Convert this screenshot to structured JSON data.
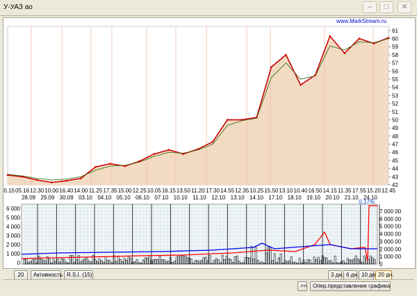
{
  "window": {
    "title": "У-УАЗ ао"
  },
  "watermark": "www.MarkStream.ru",
  "price_chart": {
    "y_ticks": [
      "61",
      "60",
      "59",
      "58",
      "57",
      "56",
      "55",
      "54",
      "53",
      "52",
      "51",
      "50",
      "49",
      "48",
      "47",
      "46",
      "45",
      "44",
      "43",
      "42"
    ],
    "x_labels": [
      "20.15",
      "05.16",
      "12.30",
      "10.00",
      "16.40",
      "14.00",
      "11.25",
      "17.35",
      "15.00",
      "12.25",
      "10.05",
      "16.15",
      "13.50",
      "11.20",
      "17.30",
      "14.55",
      "12.35",
      "10.25",
      "15.50",
      "13.10",
      "10.40",
      "16.50",
      "14.15",
      "11.35",
      "17.55",
      "15.20",
      "12.45"
    ]
  },
  "indicator_panel": {
    "date_labels": [
      "28.09",
      "29.09",
      "30.09",
      "03.10",
      "04.10",
      "05.10",
      "06.10",
      "07.10",
      "10.10",
      "11.10",
      "12.10",
      "13.10",
      "14.10",
      "17.10",
      "18.10",
      "19.10",
      "20.10",
      "21.10",
      "24.10"
    ],
    "left_ticks": [
      "6 000",
      "5 000",
      "4 000",
      "3 000",
      "2 000",
      "1 000",
      "0"
    ],
    "right_ticks": [
      "7 000 00",
      "6 000 00",
      "5 000 00",
      "4 000 00",
      "3 000 00",
      "2 000 00",
      "1 000 00",
      "0"
    ],
    "badge": "0,17%"
  },
  "chart_data": {
    "type": "line",
    "title": "",
    "xlabel": "",
    "ylabel": "",
    "ylim": [
      42,
      61.5
    ],
    "x": [
      "20.15",
      "05.16",
      "12.30",
      "10.00",
      "16.40",
      "14.00",
      "11.25",
      "17.35",
      "15.00",
      "12.25",
      "10.05",
      "16.15",
      "13.50",
      "11.20",
      "17.30",
      "14.55",
      "12.35",
      "10.25",
      "15.50",
      "13.10",
      "10.40",
      "16.50",
      "14.15",
      "11.35",
      "17.55",
      "15.20",
      "12.45"
    ],
    "series": [
      {
        "values": [
          43.2,
          43.0,
          42.6,
          42.3,
          42.5,
          42.8,
          44.2,
          44.6,
          44.3,
          44.9,
          45.8,
          46.3,
          45.8,
          46.4,
          47.3,
          50.0,
          50.0,
          50.3,
          56.5,
          58.0,
          54.3,
          55.5,
          60.3,
          58.2,
          60.0,
          59.4,
          60.1
        ]
      },
      {
        "values": [
          43.3,
          43.1,
          42.8,
          42.6,
          42.7,
          43.0,
          43.8,
          44.3,
          44.4,
          44.8,
          45.5,
          46.0,
          45.9,
          46.3,
          47.0,
          49.3,
          49.9,
          50.2,
          55.2,
          57.0,
          55.0,
          55.4,
          59.1,
          58.6,
          59.6,
          59.5,
          60.0
        ]
      }
    ]
  },
  "buttons": {
    "period": "20",
    "activity": "Активность",
    "rsi": "R.S.I.  (15)",
    "scroll": ">>",
    "d3": "3 дн.",
    "d6": "6 дн.",
    "d10": "10 дн.",
    "d20": "20 дн.",
    "oper": "Опер.представление графика"
  },
  "colors": {
    "price_fill": "#f3dac3",
    "price_line": "#cc0000",
    "ma_line": "#3a6e1a",
    "rsi_red": "#ff0000",
    "rsi_blue": "#0000ee"
  }
}
